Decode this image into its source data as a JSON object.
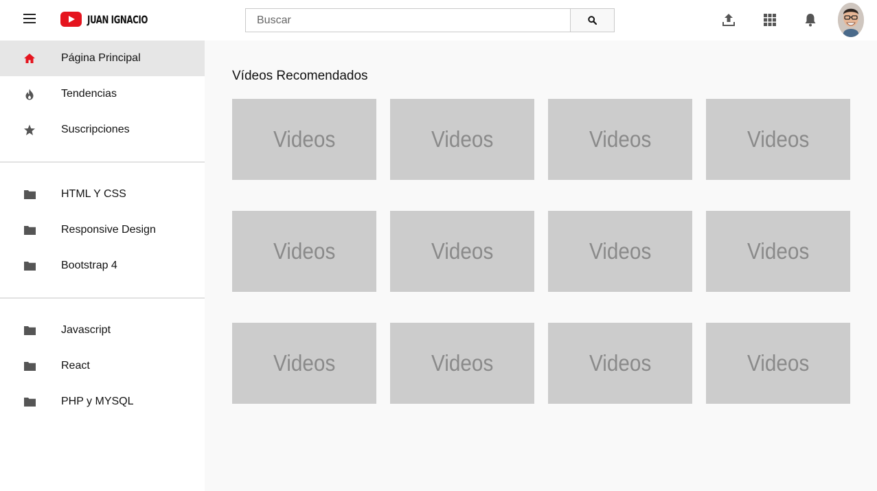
{
  "header": {
    "brand": "JUAN IGNACIO",
    "search": {
      "placeholder": "Buscar",
      "value": ""
    },
    "icons": [
      "menu-icon",
      "youtube-logo-icon",
      "search-icon",
      "upload-icon",
      "apps-grid-icon",
      "bell-icon"
    ]
  },
  "sidebar": {
    "main": [
      {
        "label": "Página Principal",
        "icon": "home-icon",
        "active": true
      },
      {
        "label": "Tendencias",
        "icon": "fire-icon"
      },
      {
        "label": "Suscripciones",
        "icon": "star-icon"
      }
    ],
    "group1": [
      {
        "label": "HTML Y CSS",
        "icon": "folder-icon"
      },
      {
        "label": "Responsive Design",
        "icon": "folder-icon"
      },
      {
        "label": "Bootstrap 4",
        "icon": "folder-icon"
      }
    ],
    "group2": [
      {
        "label": "Javascript",
        "icon": "folder-icon"
      },
      {
        "label": "React",
        "icon": "folder-icon"
      },
      {
        "label": "PHP y MYSQL",
        "icon": "folder-icon"
      }
    ]
  },
  "main": {
    "title": "Vídeos Recomendados",
    "videos": [
      "Videos",
      "Videos",
      "Videos",
      "Videos",
      "Videos",
      "Videos",
      "Videos",
      "Videos",
      "Videos",
      "Videos",
      "Videos",
      "Videos"
    ]
  },
  "colors": {
    "brand_red": "#e5141e",
    "active_item_bg": "#e6e6e6",
    "placeholder_bg": "#cccccc",
    "page_bg": "#f9f9f9"
  }
}
